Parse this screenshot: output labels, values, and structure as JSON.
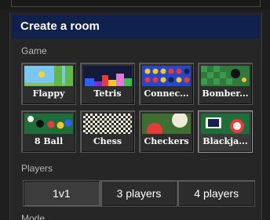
{
  "panel": {
    "title": "Create a room"
  },
  "game_section": {
    "label": "Game",
    "games": [
      {
        "label": "Flappy",
        "icon": "flappy-thumbnail"
      },
      {
        "label": "Tetris",
        "icon": "tetris-thumbnail"
      },
      {
        "label": "Connec...",
        "icon": "connect-four-thumbnail"
      },
      {
        "label": "Bomber...",
        "icon": "bomberman-thumbnail"
      },
      {
        "label": "8 Ball",
        "icon": "eight-ball-thumbnail"
      },
      {
        "label": "Chess",
        "icon": "chess-thumbnail"
      },
      {
        "label": "Checkers",
        "icon": "checkers-thumbnail"
      },
      {
        "label": "Blackja...",
        "icon": "blackjack-thumbnail",
        "selected": true
      }
    ]
  },
  "players_section": {
    "label": "Players",
    "options": [
      {
        "label": "1v1",
        "selected": true
      },
      {
        "label": "3 players"
      },
      {
        "label": "4 players"
      }
    ]
  },
  "next_section": {
    "label": "Mode"
  },
  "colors": {
    "header_bg": "#10214d",
    "panel_bg": "#262626",
    "page_bg": "#1e1e1e"
  }
}
